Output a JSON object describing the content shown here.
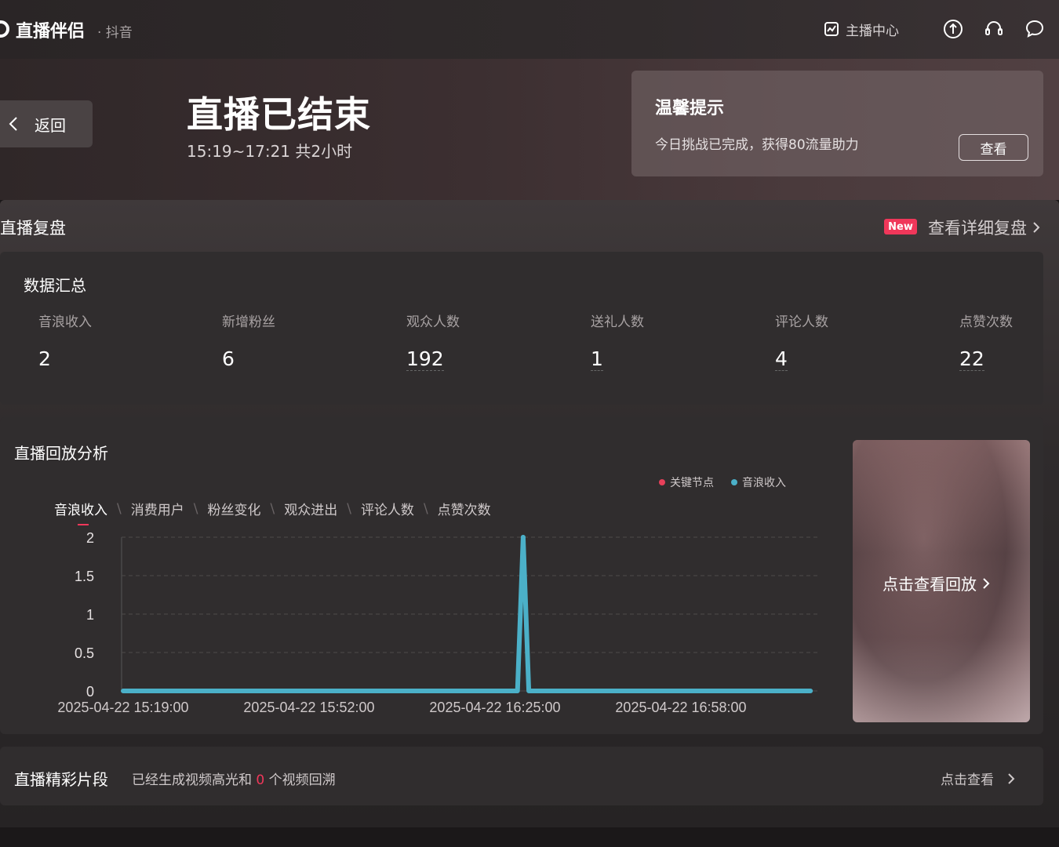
{
  "app": {
    "title": "直播伴侣",
    "subtitle": "· 抖音",
    "host_center": "主播中心"
  },
  "hero": {
    "back_label": "返回",
    "ended_title": "直播已结束",
    "time_range": "15:19~17:21 共2小时",
    "tip": {
      "title": "温馨提示",
      "text": "今日挑战已完成，获得80流量助力",
      "button": "查看"
    }
  },
  "review": {
    "title": "直播复盘",
    "new_badge": "New",
    "detail_link": "查看详细复盘"
  },
  "summary": {
    "title": "数据汇总",
    "stats": [
      {
        "label": "音浪收入",
        "value": "2"
      },
      {
        "label": "新增粉丝",
        "value": "6"
      },
      {
        "label": "观众人数",
        "value": "192"
      },
      {
        "label": "送礼人数",
        "value": "1"
      },
      {
        "label": "评论人数",
        "value": "4"
      },
      {
        "label": "点赞次数",
        "value": "22"
      }
    ]
  },
  "replay": {
    "title": "直播回放分析",
    "legend": [
      {
        "label": "关键节点",
        "color": "#e8405a"
      },
      {
        "label": "音浪收入",
        "color": "#4bb0c8"
      }
    ],
    "tabs": [
      "音浪收入",
      "消费用户",
      "粉丝变化",
      "观众进出",
      "评论人数",
      "点赞次数"
    ],
    "active_tab": 0,
    "thumbnail_link": "点击查看回放"
  },
  "chart_data": {
    "type": "line",
    "title": "",
    "xlabel": "",
    "ylabel": "",
    "ylim": [
      0,
      2
    ],
    "yticks": [
      "0",
      "0.5",
      "1",
      "1.5",
      "2"
    ],
    "xtick_labels": [
      "2025-04-22 15:19:00",
      "2025-04-22 15:52:00",
      "2025-04-22 16:25:00",
      "2025-04-22 16:58:00"
    ],
    "x": [
      "2025-04-22 15:19:00",
      "2025-04-22 15:52:00",
      "2025-04-22 16:25:00",
      "2025-04-22 16:29:00",
      "2025-04-22 16:30:00",
      "2025-04-22 16:31:00",
      "2025-04-22 16:58:00",
      "2025-04-22 17:21:00"
    ],
    "series": [
      {
        "name": "音浪收入",
        "color": "#4bb0c8",
        "values": [
          0,
          0,
          0,
          0,
          2,
          0,
          0,
          0
        ]
      }
    ],
    "grid": true
  },
  "highlights": {
    "title": "直播精彩片段",
    "desc_prefix": "已经生成视频高光和",
    "count": "0",
    "desc_suffix": "个视频回溯",
    "link": "点击查看"
  }
}
